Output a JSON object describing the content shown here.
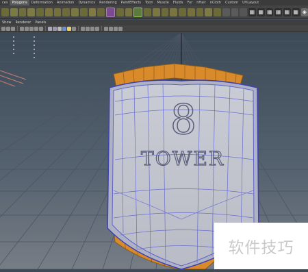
{
  "shelf_tabs": [
    "ces",
    "Polygons",
    "Deformation",
    "Animation",
    "Dynamics",
    "Rendering",
    "PaintEffects",
    "Toon",
    "Muscle",
    "Fluids",
    "Fur",
    "nHair",
    "nCloth",
    "Custom",
    "UVLayout"
  ],
  "active_tab": "Polygons",
  "panel_menu": [
    "Show",
    "Renderer",
    "Panels"
  ],
  "emblem": {
    "number": "8",
    "label": "TOWER"
  },
  "watermark": "软件技巧",
  "colors": {
    "grid_bg_top": "#3c4a58",
    "grid_bg_bottom": "#707780",
    "wood": "#d98a2a",
    "mesh": "#5f63c8",
    "shield_fill": "#c5c8d0"
  }
}
